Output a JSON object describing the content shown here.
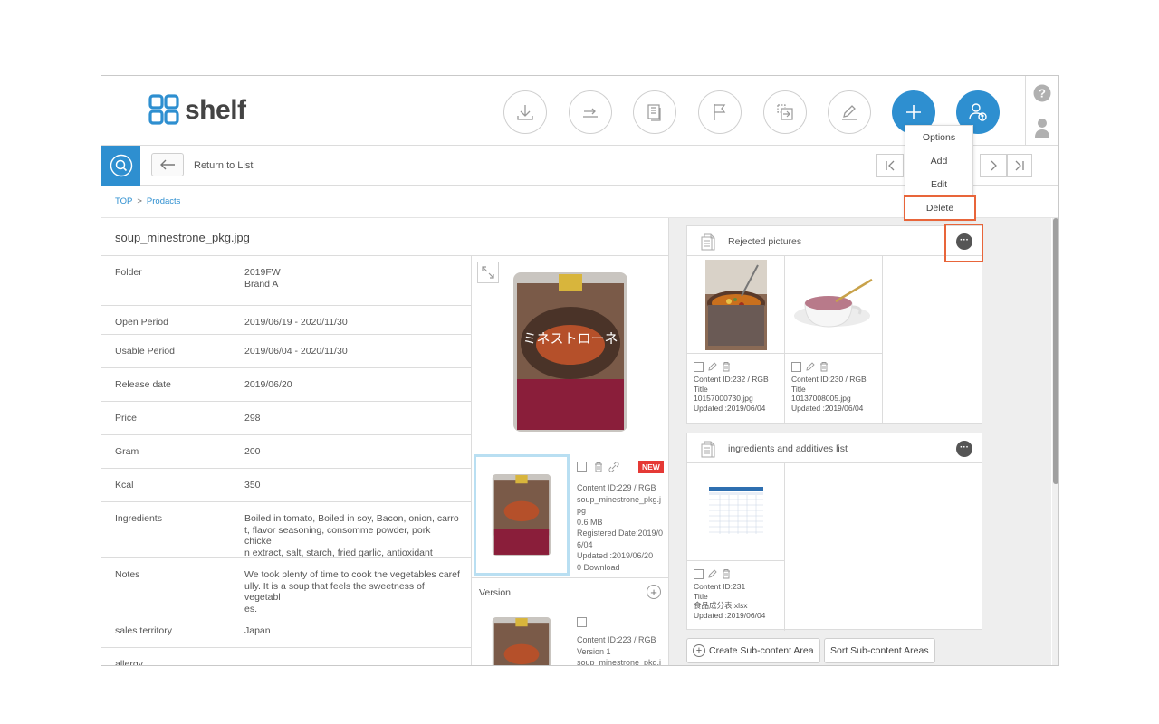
{
  "app": {
    "name": "shelf"
  },
  "toolbar": {
    "buttons": [
      {
        "name": "download-button",
        "icon": "download-icon"
      },
      {
        "name": "share-button",
        "icon": "export-arrow-icon"
      },
      {
        "name": "document-button",
        "icon": "document-icon"
      },
      {
        "name": "flag-button",
        "icon": "flag-icon"
      },
      {
        "name": "move-button",
        "icon": "move-into-icon"
      },
      {
        "name": "edit-button",
        "icon": "pencil-icon"
      },
      {
        "name": "add-button",
        "icon": "plus-icon"
      },
      {
        "name": "user-upload-button",
        "icon": "user-upload-icon"
      }
    ],
    "accent": "#2e8fd0"
  },
  "dropdown": {
    "items": [
      "Options",
      "Add",
      "Edit",
      "Delete"
    ],
    "highlighted": "Delete",
    "highlight_color": "#e8653a"
  },
  "subbar": {
    "return_label": "Return to List"
  },
  "breadcrumb": {
    "items": [
      "TOP",
      "Prodacts"
    ],
    "separator": ">"
  },
  "file": {
    "name": "soup_minestrone_pkg.jpg"
  },
  "properties": [
    {
      "key": "Folder",
      "value": "2019FW\nBrand A"
    },
    {
      "key": "Open Period",
      "value": "2019/06/19 - 2020/11/30"
    },
    {
      "key": "Usable Period",
      "value": "2019/06/04 - 2020/11/30"
    },
    {
      "key": "Release date",
      "value": "2019/06/20"
    },
    {
      "key": "Price",
      "value": "298"
    },
    {
      "key": "Gram",
      "value": "200"
    },
    {
      "key": "Kcal",
      "value": "350"
    },
    {
      "key": "Ingredients",
      "value": "Boiled in tomato, Boiled in soy, Bacon, onion, carro\nt, flavor seasoning, consomme powder, pork chicke\nn extract, salt, starch, fried garlic, antioxidant"
    },
    {
      "key": "Notes",
      "value": "We took plenty of time to cook the vegetables caref\nully. It is a soup that feels the sweetness of vegetabl\nes."
    },
    {
      "key": "sales territory",
      "value": "Japan"
    },
    {
      "key": "allergy",
      "value": ""
    }
  ],
  "current_content": {
    "badge": "NEW",
    "lines": [
      "Content ID:229 / RGB",
      "soup_minestrone_pkg.j",
      "pg",
      "0.6 MB",
      "Registered Date:2019/0",
      "6/04",
      "Updated :2019/06/20",
      "0 Download"
    ]
  },
  "version": {
    "label": "Version",
    "lines": [
      "Content ID:223 / RGB",
      "Version 1",
      "soup_minestrone_pkg.j"
    ]
  },
  "sections": [
    {
      "title": "Rejected pictures",
      "cards": [
        {
          "meta": "Content ID:232 / RGB\nTitle\n10157000730.jpg\nUpdated :2019/06/04"
        },
        {
          "meta": "Content ID:230 / RGB\nTitle\n10137008005.jpg\nUpdated :2019/06/04"
        }
      ]
    },
    {
      "title": "ingredients and additives list",
      "cards": [
        {
          "meta": "Content ID:231\nTitle\n食品成分表.xlsx\nUpdated :2019/06/04"
        }
      ]
    }
  ],
  "buttons": {
    "create_sub": "Create Sub-content Area",
    "sort_sub": "Sort Sub-content Areas"
  }
}
